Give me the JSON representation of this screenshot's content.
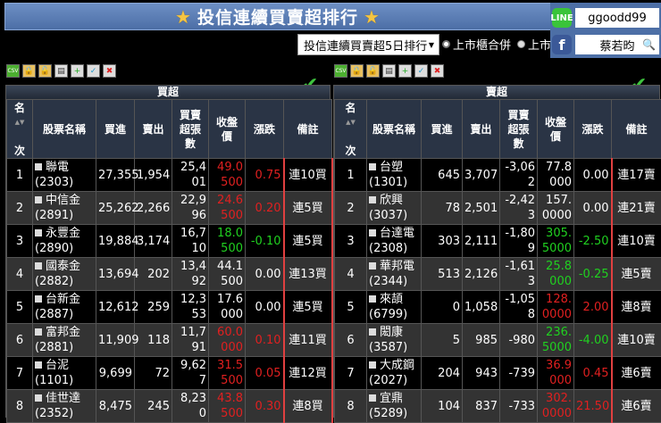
{
  "title": "投信連續買賣超排行",
  "social": {
    "line_id": "ggoodd99",
    "fb_name": "蔡若昀"
  },
  "select": {
    "value": "投信連續買賣超5日排行"
  },
  "radios": [
    {
      "label": "上市櫃合併",
      "selected": true
    },
    {
      "label": "上市",
      "selected": false
    }
  ],
  "toolbar": [
    "CSV",
    "lock",
    "lock",
    "print",
    "add",
    "check",
    "delete"
  ],
  "columns": {
    "rank_top": "名",
    "rank_bottom": "次",
    "name": "股票名稱",
    "buy": "買進",
    "sell": "賣出",
    "net": "買賣超張數",
    "close": "收盤價",
    "change": "漲跌",
    "note": "備註"
  },
  "colors": {
    "up": "#e02020",
    "down": "#20d020"
  },
  "tables": [
    {
      "title": "買超",
      "rows": [
        {
          "rank": "1",
          "name": "聯電",
          "code": "(2303)",
          "buy": "27,355",
          "sell": "1,954",
          "net": "25,401",
          "close": "49.0500",
          "change": "0.75",
          "dir": "up",
          "note": "連10買"
        },
        {
          "rank": "2",
          "name": "中信金",
          "code": "(2891)",
          "buy": "25,262",
          "sell": "2,266",
          "net": "22,996",
          "close": "24.6500",
          "change": "0.20",
          "dir": "up",
          "note": "連5買"
        },
        {
          "rank": "3",
          "name": "永豐金",
          "code": "(2890)",
          "buy": "19,884",
          "sell": "3,174",
          "net": "16,710",
          "close": "18.0500",
          "change": "-0.10",
          "dir": "down",
          "note": "連5買"
        },
        {
          "rank": "4",
          "name": "國泰金",
          "code": "(2882)",
          "buy": "13,694",
          "sell": "202",
          "net": "13,492",
          "close": "44.1500",
          "change": "0.00",
          "dir": "flat",
          "note": "連13買"
        },
        {
          "rank": "5",
          "name": "台新金",
          "code": "(2887)",
          "buy": "12,612",
          "sell": "259",
          "net": "12,353",
          "close": "17.6000",
          "change": "0.00",
          "dir": "flat",
          "note": "連5買"
        },
        {
          "rank": "6",
          "name": "富邦金",
          "code": "(2881)",
          "buy": "11,909",
          "sell": "118",
          "net": "11,791",
          "close": "60.0000",
          "change": "0.10",
          "dir": "up",
          "note": "連11買"
        },
        {
          "rank": "7",
          "name": "台泥",
          "code": "(1101)",
          "buy": "9,699",
          "sell": "72",
          "net": "9,627",
          "close": "31.5500",
          "change": "0.05",
          "dir": "up",
          "note": "連12買"
        },
        {
          "rank": "8",
          "name": "佳世達",
          "code": "(2352)",
          "buy": "8,475",
          "sell": "245",
          "net": "8,230",
          "close": "43.8500",
          "change": "0.30",
          "dir": "up",
          "note": "連8買"
        }
      ]
    },
    {
      "title": "賣超",
      "rows": [
        {
          "rank": "1",
          "name": "台塑",
          "code": "(1301)",
          "buy": "645",
          "sell": "3,707",
          "net": "-3,062",
          "close": "77.8000",
          "change": "0.00",
          "dir": "flat",
          "note": "連17賣"
        },
        {
          "rank": "2",
          "name": "欣興",
          "code": "(3037)",
          "buy": "78",
          "sell": "2,501",
          "net": "-2,423",
          "close": "157.0000",
          "change": "0.00",
          "dir": "flat",
          "note": "連21賣"
        },
        {
          "rank": "3",
          "name": "台達電",
          "code": "(2308)",
          "buy": "303",
          "sell": "2,111",
          "net": "-1,809",
          "close": "305.5000",
          "change": "-2.50",
          "dir": "down",
          "note": "連10賣"
        },
        {
          "rank": "4",
          "name": "華邦電",
          "code": "(2344)",
          "buy": "513",
          "sell": "2,126",
          "net": "-1,613",
          "close": "25.8000",
          "change": "-0.25",
          "dir": "down",
          "note": "連5賣"
        },
        {
          "rank": "5",
          "name": "來頡",
          "code": "(6799)",
          "buy": "0",
          "sell": "1,058",
          "net": "-1,058",
          "close": "128.0000",
          "change": "2.00",
          "dir": "up",
          "note": "連8賣"
        },
        {
          "rank": "6",
          "name": "閎康",
          "code": "(3587)",
          "buy": "5",
          "sell": "985",
          "net": "-980",
          "close": "236.5000",
          "change": "-4.00",
          "dir": "down",
          "note": "連10賣"
        },
        {
          "rank": "7",
          "name": "大成鋼",
          "code": "(2027)",
          "buy": "204",
          "sell": "943",
          "net": "-739",
          "close": "36.9000",
          "change": "0.45",
          "dir": "up",
          "note": "連6賣"
        },
        {
          "rank": "8",
          "name": "宜鼎",
          "code": "(5289)",
          "buy": "104",
          "sell": "837",
          "net": "-733",
          "close": "302.0000",
          "change": "21.50",
          "dir": "up",
          "note": "連6賣"
        }
      ]
    }
  ]
}
